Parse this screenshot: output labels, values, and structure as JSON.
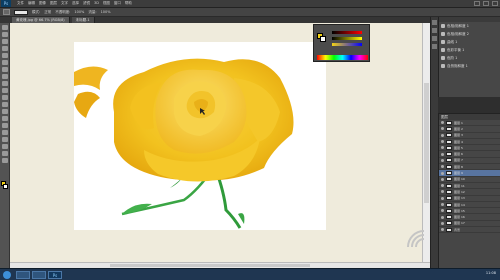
{
  "app": {
    "logo": "Ps",
    "menus": [
      "文件",
      "编辑",
      "图像",
      "图层",
      "文字",
      "选择",
      "滤镜",
      "3D",
      "视图",
      "窗口",
      "帮助"
    ]
  },
  "options": {
    "labels": [
      "模式:",
      "正常",
      "不透明度:",
      "100%",
      "流量:",
      "100%"
    ]
  },
  "tabs": [
    {
      "label": "黄玫瑰.jpg @ 66.7% (RGB/8)"
    },
    {
      "label": "未标题-1"
    }
  ],
  "adjustments": {
    "items": [
      "色相/饱和度 1",
      "色相/饱和度 2",
      "曲线 1",
      "色彩平衡 1",
      "色阶 1",
      "自然饱和度 1"
    ]
  },
  "layers": {
    "header": "图层",
    "rows": [
      "图层 1",
      "图层 2",
      "图层 3",
      "图层 4",
      "图层 5",
      "图层 6",
      "图层 7",
      "图层 8",
      "图层 9",
      "图层 10",
      "图层 11",
      "图层 12",
      "图层 13",
      "图层 14",
      "图层 15",
      "图层 16",
      "图层 17",
      "背景"
    ],
    "active_index": 8
  },
  "colors": {
    "foreground": "#f3d214",
    "background": "#ffffff",
    "workarea": "#efebdc"
  },
  "status": {
    "clock": "11:08"
  }
}
